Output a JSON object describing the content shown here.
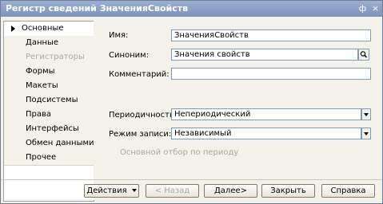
{
  "window": {
    "title": "Регистр сведений ЗначенияСвойств",
    "pin_glyph": "ф",
    "close_glyph": "×"
  },
  "sidebar": {
    "items": [
      {
        "label": "Основные",
        "active": true,
        "disabled": false
      },
      {
        "label": "Данные",
        "active": false,
        "disabled": false
      },
      {
        "label": "Регистраторы",
        "active": false,
        "disabled": true
      },
      {
        "label": "Формы",
        "active": false,
        "disabled": false
      },
      {
        "label": "Макеты",
        "active": false,
        "disabled": false
      },
      {
        "label": "Подсистемы",
        "active": false,
        "disabled": false
      },
      {
        "label": "Права",
        "active": false,
        "disabled": false
      },
      {
        "label": "Интерфейсы",
        "active": false,
        "disabled": false
      },
      {
        "label": "Обмен данными",
        "active": false,
        "disabled": false
      },
      {
        "label": "Прочее",
        "active": false,
        "disabled": false
      }
    ]
  },
  "form": {
    "name_label": "Имя:",
    "name_value": "ЗначенияСвойств",
    "synonym_label": "Синоним:",
    "synonym_value": "Значения свойств",
    "comment_label": "Комментарий:",
    "comment_value": "",
    "periodicity_label": "Периодичность:",
    "periodicity_value": "Непериодический",
    "write_mode_label": "Режим записи:",
    "write_mode_value": "Независимый",
    "period_filter_label": "Основной отбор по периоду",
    "period_filter_checked": false
  },
  "buttons": {
    "actions": "Действия",
    "back": "< Назад",
    "next": "Далее>",
    "close": "Закрыть",
    "help": "Справка"
  },
  "colors": {
    "titlebar": "#8ea3c6",
    "panel": "#f3f1e9",
    "field_border": "#7f9db9"
  }
}
